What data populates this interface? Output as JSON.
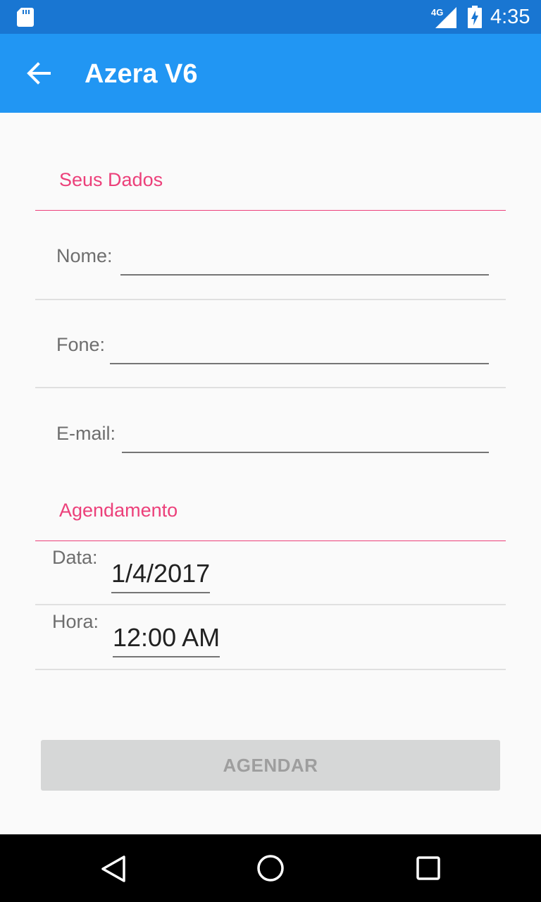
{
  "status_bar": {
    "time": "4:35",
    "network": "4G",
    "icons": [
      "sd-card-icon",
      "signal-icon",
      "battery-icon"
    ]
  },
  "app_bar": {
    "title": "Azera V6",
    "back_icon": "arrow-back-icon"
  },
  "form": {
    "section_personal": {
      "title": "Seus Dados"
    },
    "name": {
      "label": "Nome:",
      "value": ""
    },
    "phone": {
      "label": "Fone:",
      "value": ""
    },
    "email": {
      "label": "E-mail:",
      "value": ""
    },
    "section_schedule": {
      "title": "Agendamento"
    },
    "date": {
      "label": "Data:",
      "value": "1/4/2017"
    },
    "time": {
      "label": "Hora:",
      "value": "12:00 AM"
    }
  },
  "action": {
    "label": "AGENDAR",
    "enabled": false
  },
  "colors": {
    "status_bar": "#1976d2",
    "app_bar": "#2196f3",
    "accent": "#ec407a",
    "button_disabled": "#d6d7d7"
  },
  "nav_bar": {
    "icons": [
      "nav-back-icon",
      "nav-home-icon",
      "nav-recents-icon"
    ]
  }
}
